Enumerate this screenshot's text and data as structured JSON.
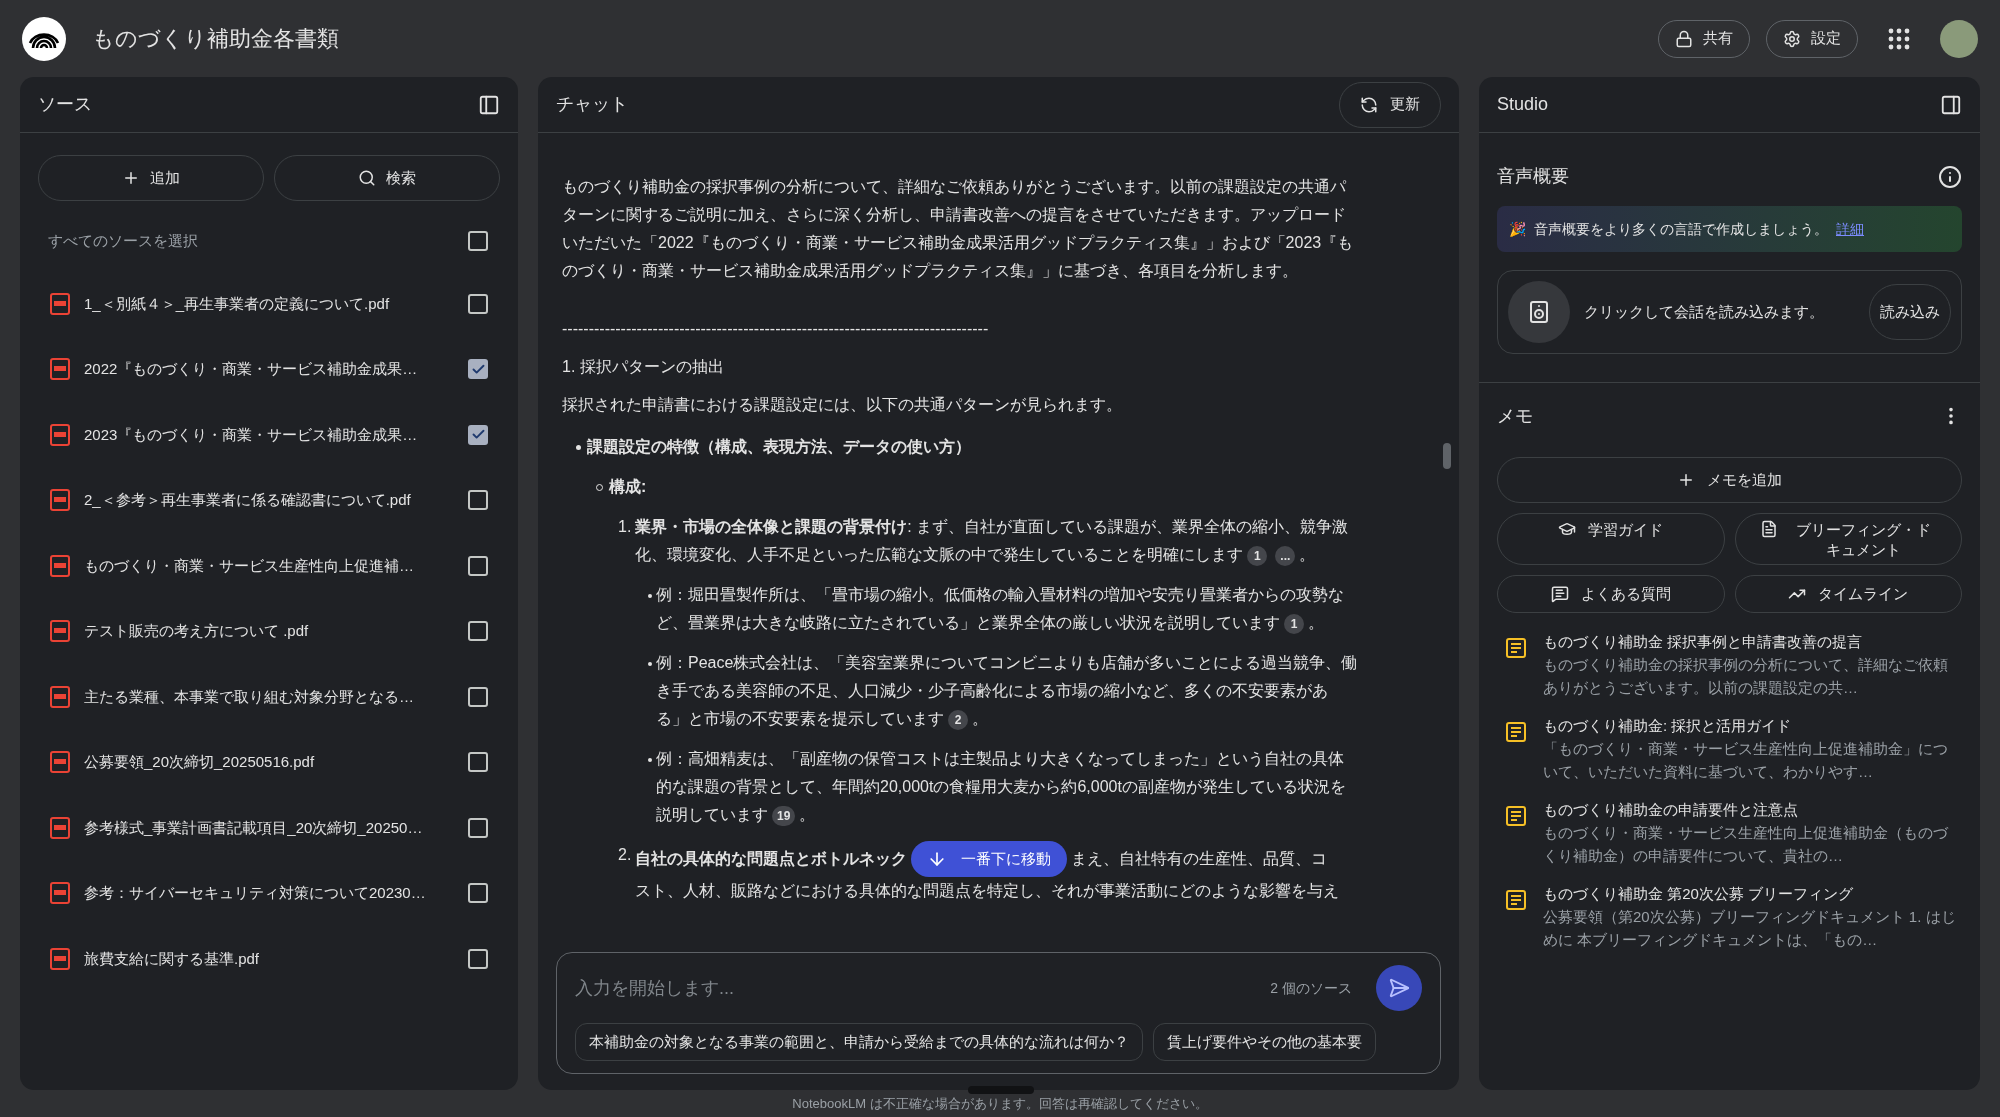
{
  "app": {
    "title": "ものづくり補助金各書類",
    "share_label": "共有",
    "settings_label": "設定"
  },
  "sources": {
    "title": "ソース",
    "add_label": "追加",
    "search_label": "検索",
    "select_all": {
      "label": "すべてのソースを選択",
      "checked": false
    },
    "items": [
      {
        "name": "1_＜別紙４＞_再生事業者の定義について.pdf",
        "checked": false
      },
      {
        "name": "2022『ものづくり・商業・サービス補助金成果…",
        "checked": true
      },
      {
        "name": "2023『ものづくり・商業・サービス補助金成果…",
        "checked": true
      },
      {
        "name": "2_＜参考＞再生事業者に係る確認書について.pdf",
        "checked": false
      },
      {
        "name": "ものづくり・商業・サービス生産性向上促進補…",
        "checked": false
      },
      {
        "name": "テスト販売の考え方について .pdf",
        "checked": false
      },
      {
        "name": "主たる業種、本事業で取り組む対象分野となる…",
        "checked": false
      },
      {
        "name": "公募要領_20次締切_20250516.pdf",
        "checked": false
      },
      {
        "name": "参考様式_事業計画書記載項目_20次締切_20250…",
        "checked": false
      },
      {
        "name": "参考：サイバーセキュリティ対策について20230…",
        "checked": false
      },
      {
        "name": "旅費支給に関する基準.pdf",
        "checked": false
      }
    ]
  },
  "chat": {
    "title": "チャット",
    "refresh_label": "更新",
    "blocks": [
      {
        "kind": "paragraph",
        "text": "ものづくり補助金の採択事例の分析について、詳細なご依頼ありがとうございます。以前の課題設定の共通パターンに関するご説明に加え、さらに深く分析し、申請書改善への提言をさせていただきます。アップロードいただいた「2022『ものづくり・商業・サービス補助金成果活用グッドプラクティス集』」および「2023『ものづくり・商業・サービス補助金成果活用グッドプラクティス集』」に基づき、各項目を分析します。"
      },
      {
        "kind": "rule",
        "text": "--------------------------------------------------------------------------------"
      },
      {
        "kind": "heading",
        "text": "1. 採択パターンの抽出"
      },
      {
        "kind": "paragraph",
        "text": "採択された申請書における課題設定には、以下の共通パターンが見られます。"
      },
      {
        "kind": "bullet",
        "text": "課題設定の特徴（構成、表現方法、データの使い方）"
      },
      {
        "kind": "circle",
        "text": "構成:"
      },
      {
        "kind": "numbered",
        "number": "1.",
        "text": "**業界・市場の全体像と課題の背景付け**: まず、自社が直面している課題が、業界全体の縮小、競争激化、環境変化、人手不足といった広範な文脈の中で発生していることを明確にします",
        "citations": [
          "1",
          "..."
        ],
        "end": "。"
      },
      {
        "kind": "example",
        "text": "例：堀田畳製作所は、「畳市場の縮小。低価格の輸入畳材料の増加や安売り畳業者からの攻勢など、畳業界は大きな岐路に立たされている」と業界全体の厳しい状況を説明しています",
        "citations": [
          "1"
        ],
        "end": "。"
      },
      {
        "kind": "example",
        "text": "例：Peace株式会社は、「美容室業界についてコンビニよりも店舗が多いことによる過当競争、働き手である美容師の不足、人口減少・少子高齢化による市場の縮小など、多くの不安要素がある」と市場の不安要素を提示しています",
        "citations": [
          "2"
        ],
        "end": "。"
      },
      {
        "kind": "example",
        "text": "例：高畑精麦は、「副産物の保管コストは主製品より大きくなってしまった」という自社の具体的な課題の背景として、年間約20,000tの食糧用大麦から約6,000tの副産物が発生している状況を説明しています",
        "citations": [
          "19"
        ],
        "end": "。"
      },
      {
        "kind": "numbered_cut",
        "number": "2.",
        "text": "**自社の具体的な問題点とボトルネック**",
        "rest_lines": [
          "まえ、自社特有の生産性、品質、コ",
          "スト、人材、販路などにおける具体的な問題点を特定し、それが事業活動にどのような影響を与え"
        ]
      }
    ],
    "scroll_button_label": "一番下に移動",
    "input": {
      "placeholder": "入力を開始します...",
      "source_count": "2 個のソース"
    },
    "suggestions": [
      "本補助金の対象となる事業の範囲と、申請から受給までの具体的な流れは何か？",
      "賃上げ要件やその他の基本要"
    ]
  },
  "studio": {
    "title": "Studio",
    "audio": {
      "title": "音声概要",
      "banner_icon": "🎉",
      "banner_text": "音声概要をより多くの言語で作成しましょう。",
      "banner_link": "詳細",
      "load_text": "クリックして会話を読み込みます。",
      "load_button": "読み込み"
    },
    "memo": {
      "title": "メモ",
      "add_label": "メモを追加",
      "actions": [
        {
          "kind": "study",
          "label": "学習ガイド"
        },
        {
          "kind": "briefing",
          "label": "ブリーフィング・ドキュメント"
        },
        {
          "kind": "faq",
          "label": "よくある質問"
        },
        {
          "kind": "timeline",
          "label": "タイムライン"
        }
      ],
      "notes": [
        {
          "title": "ものづくり補助金 採択事例と申請書改善の提言",
          "preview": "ものづくり補助金の採択事例の分析について、詳細なご依頼ありがとうございます。以前の課題設定の共…"
        },
        {
          "title": "ものづくり補助金: 採択と活用ガイド",
          "preview": "「ものづくり・商業・サービス生産性向上促進補助金」について、いただいた資料に基づいて、わかりやす…"
        },
        {
          "title": "ものづくり補助金の申請要件と注意点",
          "preview": "ものづくり・商業・サービス生産性向上促進補助金（ものづくり補助金）の申請要件について、貴社の…"
        },
        {
          "title": "ものづくり補助金 第20次公募 ブリーフィング",
          "preview": "公募要領（第20次公募）ブリーフィングドキュメント 1. はじめに 本ブリーフィングドキュメントは、「もの…"
        }
      ]
    }
  },
  "footer": "NotebookLM は不正確な場合があります。回答は再確認してください。"
}
